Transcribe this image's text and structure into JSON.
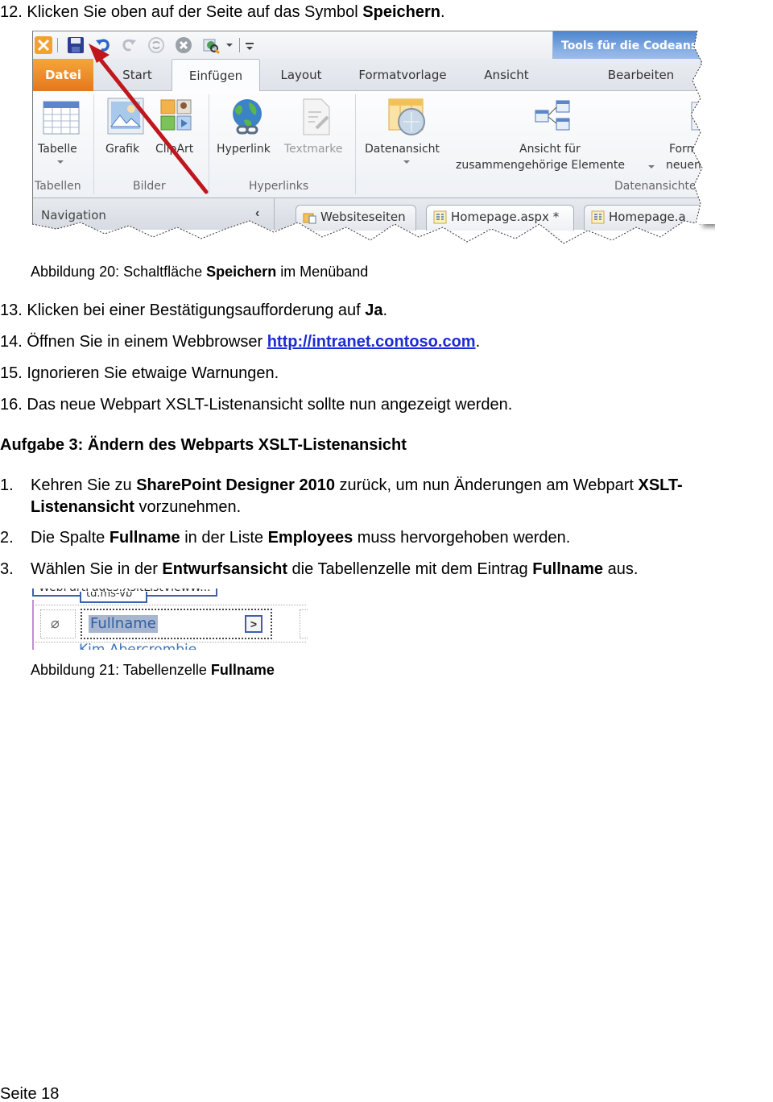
{
  "steps_part1": [
    {
      "number": "12.",
      "pre": "Klicken Sie oben auf der Seite auf das Symbol ",
      "bold": "Speichern",
      "post": "."
    }
  ],
  "figure20": {
    "caption_pre": "Abbildung 20: Schaltfläche ",
    "caption_bold": "Speichern",
    "caption_post": " im Menüband",
    "ribbon": {
      "quick_access": [
        {
          "icon": "tools-icon"
        },
        {
          "icon": "save-icon"
        },
        {
          "icon": "undo-icon"
        },
        {
          "icon": "redo-icon"
        },
        {
          "icon": "refresh-icon"
        },
        {
          "icon": "stop-icon"
        },
        {
          "icon": "preview-icon"
        },
        {
          "icon": "customize-qat-icon"
        }
      ],
      "contextual_tab_title": "Tools für die Codeansicht",
      "tabs": [
        "Datei",
        "Start",
        "Einfügen",
        "Layout",
        "Formatvorlage",
        "Ansicht",
        "Bearbeiten"
      ],
      "active_tab": "Einfügen",
      "groups": [
        {
          "label": "Tabellen",
          "commands": [
            "Tabelle"
          ]
        },
        {
          "label": "Bilder",
          "commands": [
            "Grafik",
            "ClipArt"
          ]
        },
        {
          "label": "Hyperlinks",
          "commands": [
            "Hyperlink",
            "Textmarke"
          ]
        },
        {
          "label": "Datenansichten",
          "commands": [
            "Datenansicht",
            "Ansicht für",
            "zusammengehörige Elemente",
            "Form",
            "neuen"
          ]
        }
      ],
      "navigation_label": "Navigation",
      "collapse_glyph": "‹",
      "doc_tabs": [
        "Websiteseiten",
        "Homepage.aspx *",
        "Homepage.a"
      ]
    }
  },
  "steps_part2": [
    {
      "number": "13.",
      "pre": "Klicken bei einer Bestätigungsaufforderung auf ",
      "bold": "Ja",
      "post": "."
    },
    {
      "number": "14.",
      "pre": "Öffnen Sie in einem Webbrowser ",
      "link": "http://intranet.contoso.com",
      "post": "."
    },
    {
      "number": "15.",
      "pre": "Ignorieren Sie etwaige Warnungen.",
      "post": ""
    },
    {
      "number": "16.",
      "pre": "Das neue Webpart XSLT-Listenansicht sollte nun angezeigt werden.",
      "post": ""
    }
  ],
  "section_heading": "Aufgabe 3: Ändern des Webparts XSLT-Listenansicht",
  "task3_steps": [
    {
      "number": "1.",
      "parts": [
        {
          "t": "Kehren Sie zu ",
          "b": false
        },
        {
          "t": "SharePoint Designer 2010",
          "b": true
        },
        {
          "t": " zurück, um nun Änderungen am Webpart ",
          "b": false
        },
        {
          "t": "XSLT-",
          "b": true
        }
      ],
      "line2": [
        {
          "t": "Listenansicht",
          "b": true
        },
        {
          "t": " vorzunehmen.",
          "b": false
        }
      ]
    },
    {
      "number": "2.",
      "parts": [
        {
          "t": "Die Spalte ",
          "b": false
        },
        {
          "t": "Fullname",
          "b": true
        },
        {
          "t": " in der Liste ",
          "b": false
        },
        {
          "t": "Employees",
          "b": true
        },
        {
          "t": " muss hervorgehoben werden.",
          "b": false
        }
      ]
    },
    {
      "number": "3.",
      "parts": [
        {
          "t": "Wählen Sie in der ",
          "b": false
        },
        {
          "t": "Entwurfsansicht",
          "b": true
        },
        {
          "t": " die Tabellenzelle mit dem Eintrag ",
          "b": false
        },
        {
          "t": "Fullname",
          "b": true
        },
        {
          "t": " aus.",
          "b": false
        }
      ]
    }
  ],
  "figure21": {
    "webpart_title": "WebPartPages:XsltListViewW...",
    "tag_label": "td.ms-vb",
    "cell_text": "Fullname",
    "arrow_glyph": ">",
    "clip_glyph": "📎",
    "next_row_text": "Kim Abercrombie",
    "caption_pre": "Abbildung 21: Tabellenzelle ",
    "caption_bold": "Fullname"
  },
  "footer": {
    "page_label": "Seite 18"
  },
  "colors": {
    "link": "#1b2bd6",
    "file_tab": "#e5771c",
    "contextual_tab": "#4f86cf",
    "annotation_arrow": "#c0161c",
    "selection_highlight": "#a9b6cf"
  }
}
